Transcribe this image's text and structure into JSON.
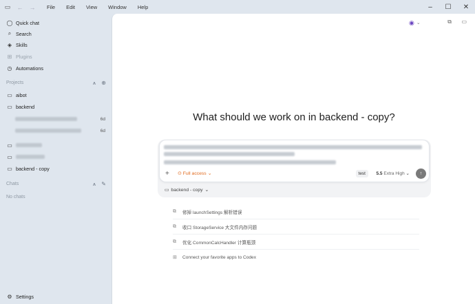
{
  "menu": [
    "File",
    "Edit",
    "View",
    "Window",
    "Help"
  ],
  "sidebar": {
    "nav": [
      {
        "label": "Quick chat",
        "icon": "chat-bubble-icon",
        "dim": false
      },
      {
        "label": "Search",
        "icon": "search-icon",
        "dim": false
      },
      {
        "label": "Skills",
        "icon": "cube-icon",
        "dim": false
      },
      {
        "label": "Plugins",
        "icon": "grid-icon",
        "dim": true
      },
      {
        "label": "Automations",
        "icon": "clock-icon",
        "dim": false
      }
    ],
    "projects_label": "Projects",
    "projects": [
      {
        "label": "aibot"
      },
      {
        "label": "backend"
      }
    ],
    "threads": [
      {
        "time": "6d"
      },
      {
        "time": "6d"
      }
    ],
    "more_projects": [
      {
        "label": "backend - copy"
      }
    ],
    "chats_label": "Chats",
    "no_chats": "No chats",
    "settings": "Settings"
  },
  "main": {
    "hero": "What should we work on in backend - copy?",
    "composer": {
      "access": "Full access",
      "tag": "test",
      "model": "5.5",
      "effort": "Extra High"
    },
    "branch": "backend - copy",
    "suggestions": [
      "修掉 launchSettings 解析错误",
      "收口 StorageService 大文件内存问题",
      "优化 CommonCalcHandler 计算瓶颈",
      "Connect your favorite apps to Codex"
    ]
  },
  "colors": {
    "accent_orange": "#e0691d",
    "sidebar_bg": "#dfe6ee",
    "main_bg": "#ffffff"
  }
}
